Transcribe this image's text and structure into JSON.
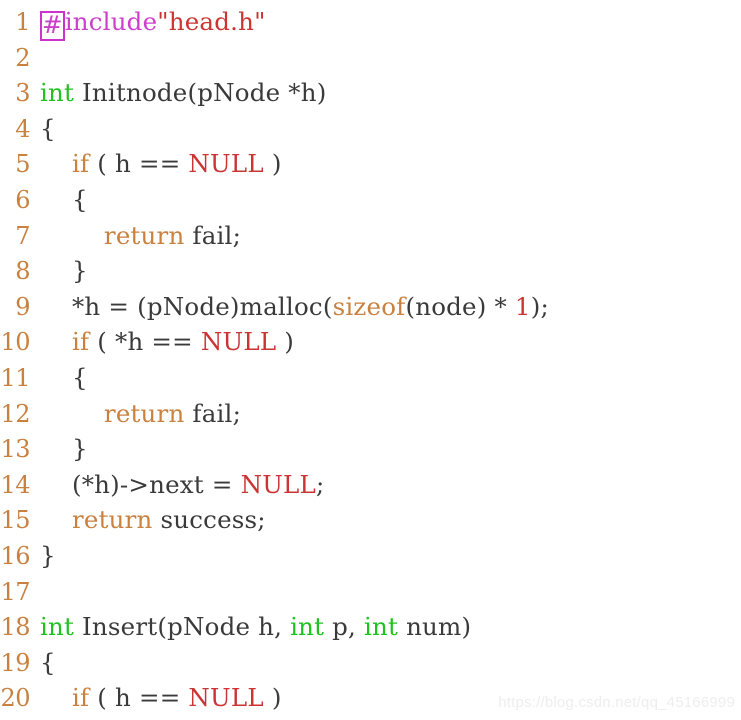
{
  "editor": {
    "language": "C",
    "colors": {
      "background": "#ffffff",
      "line_number": "#c8813f",
      "plain_text": "#3a3a3a",
      "type_keyword": "#1fc21f",
      "control_keyword": "#c8813f",
      "constant": "#cc3333",
      "string": "#cc3333",
      "number": "#cc3333",
      "preprocessor": "#cc3fcc",
      "cursor_outline": "#cc33cc",
      "watermark": "#eeeeee"
    },
    "cursor": {
      "line": 1,
      "column": 1,
      "character": "#"
    },
    "lines": [
      {
        "number": "1",
        "text": "#include\"head.h\"",
        "tokens": [
          {
            "text": "#",
            "kind": "pp",
            "cursor": true
          },
          {
            "text": "include",
            "kind": "pp"
          },
          {
            "text": "\"head.h\"",
            "kind": "str"
          }
        ]
      },
      {
        "number": "2",
        "text": "",
        "tokens": []
      },
      {
        "number": "3",
        "text": "int Initnode(pNode *h)",
        "tokens": [
          {
            "text": "int",
            "kind": "type"
          },
          {
            "text": " Initnode(pNode *h)",
            "kind": "plain"
          }
        ]
      },
      {
        "number": "4",
        "text": "{",
        "tokens": [
          {
            "text": "{",
            "kind": "punct"
          }
        ]
      },
      {
        "number": "5",
        "text": "    if ( h == NULL )",
        "tokens": [
          {
            "text": "    ",
            "kind": "plain"
          },
          {
            "text": "if",
            "kind": "kw"
          },
          {
            "text": " ( h == ",
            "kind": "plain"
          },
          {
            "text": "NULL",
            "kind": "const"
          },
          {
            "text": " )",
            "kind": "plain"
          }
        ]
      },
      {
        "number": "6",
        "text": "    {",
        "tokens": [
          {
            "text": "    {",
            "kind": "punct"
          }
        ]
      },
      {
        "number": "7",
        "text": "        return fail;",
        "tokens": [
          {
            "text": "        ",
            "kind": "plain"
          },
          {
            "text": "return",
            "kind": "kw"
          },
          {
            "text": " fail;",
            "kind": "plain"
          }
        ]
      },
      {
        "number": "8",
        "text": "    }",
        "tokens": [
          {
            "text": "    }",
            "kind": "punct"
          }
        ]
      },
      {
        "number": "9",
        "text": "    *h = (pNode)malloc(sizeof(node) * 1);",
        "tokens": [
          {
            "text": "    *h = (pNode)malloc(",
            "kind": "plain"
          },
          {
            "text": "sizeof",
            "kind": "kw"
          },
          {
            "text": "(node) * ",
            "kind": "plain"
          },
          {
            "text": "1",
            "kind": "num"
          },
          {
            "text": ");",
            "kind": "plain"
          }
        ]
      },
      {
        "number": "10",
        "text": "    if ( *h == NULL )",
        "tokens": [
          {
            "text": "    ",
            "kind": "plain"
          },
          {
            "text": "if",
            "kind": "kw"
          },
          {
            "text": " ( *h == ",
            "kind": "plain"
          },
          {
            "text": "NULL",
            "kind": "const"
          },
          {
            "text": " )",
            "kind": "plain"
          }
        ]
      },
      {
        "number": "11",
        "text": "    {",
        "tokens": [
          {
            "text": "    {",
            "kind": "punct"
          }
        ]
      },
      {
        "number": "12",
        "text": "        return fail;",
        "tokens": [
          {
            "text": "        ",
            "kind": "plain"
          },
          {
            "text": "return",
            "kind": "kw"
          },
          {
            "text": " fail;",
            "kind": "plain"
          }
        ]
      },
      {
        "number": "13",
        "text": "    }",
        "tokens": [
          {
            "text": "    }",
            "kind": "punct"
          }
        ]
      },
      {
        "number": "14",
        "text": "    (*h)->next = NULL;",
        "tokens": [
          {
            "text": "    (*h)->next = ",
            "kind": "plain"
          },
          {
            "text": "NULL",
            "kind": "const"
          },
          {
            "text": ";",
            "kind": "plain"
          }
        ]
      },
      {
        "number": "15",
        "text": "    return success;",
        "tokens": [
          {
            "text": "    ",
            "kind": "plain"
          },
          {
            "text": "return",
            "kind": "kw"
          },
          {
            "text": " success;",
            "kind": "plain"
          }
        ]
      },
      {
        "number": "16",
        "text": "}",
        "tokens": [
          {
            "text": "}",
            "kind": "punct"
          }
        ]
      },
      {
        "number": "17",
        "text": "",
        "tokens": []
      },
      {
        "number": "18",
        "text": "int Insert(pNode h, int p, int num)",
        "tokens": [
          {
            "text": "int",
            "kind": "type"
          },
          {
            "text": " Insert(pNode h, ",
            "kind": "plain"
          },
          {
            "text": "int",
            "kind": "type"
          },
          {
            "text": " p, ",
            "kind": "plain"
          },
          {
            "text": "int",
            "kind": "type"
          },
          {
            "text": " num)",
            "kind": "plain"
          }
        ]
      },
      {
        "number": "19",
        "text": "{",
        "tokens": [
          {
            "text": "{",
            "kind": "punct"
          }
        ]
      },
      {
        "number": "20",
        "text": "    if ( h == NULL )",
        "tokens": [
          {
            "text": "    ",
            "kind": "plain"
          },
          {
            "text": "if",
            "kind": "kw"
          },
          {
            "text": " ( h == ",
            "kind": "plain"
          },
          {
            "text": "NULL",
            "kind": "const"
          },
          {
            "text": " )",
            "kind": "plain"
          }
        ]
      }
    ]
  },
  "watermark": {
    "text": "https://blog.csdn.net/qq_45166999"
  }
}
